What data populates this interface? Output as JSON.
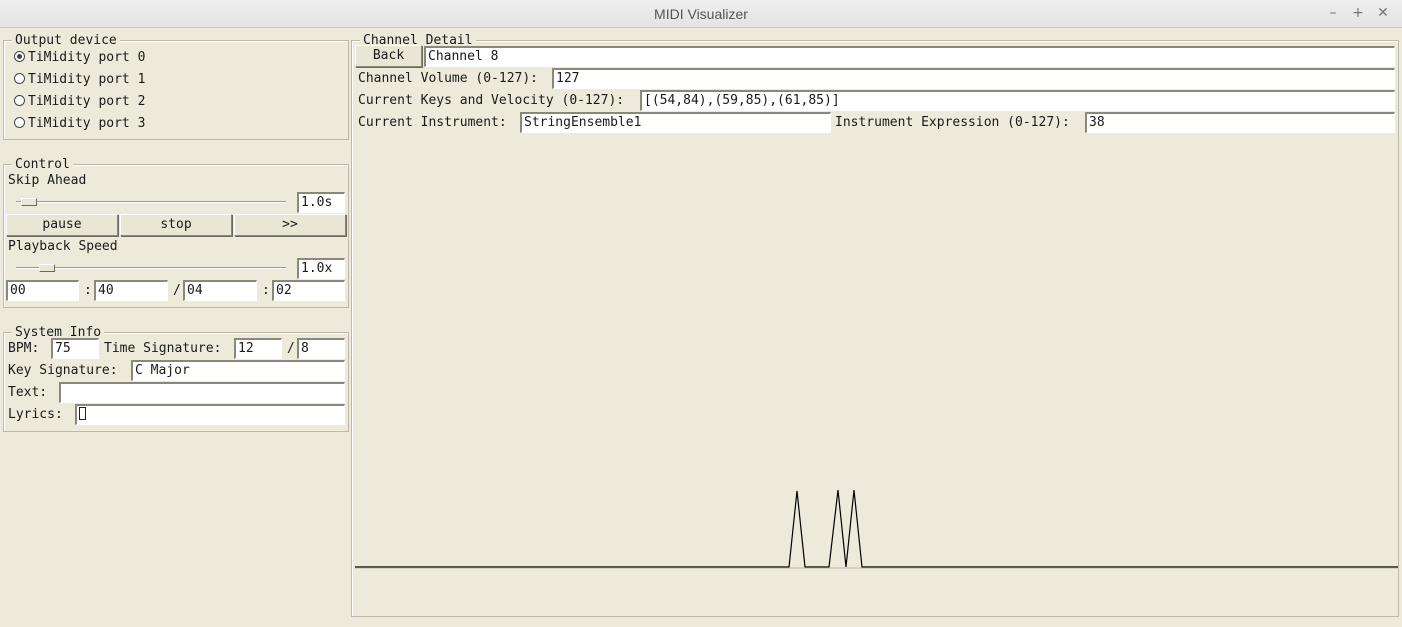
{
  "window": {
    "title": "MIDI Visualizer"
  },
  "output_device": {
    "legend": "Output device",
    "ports": [
      "TiMidity port 0",
      "TiMidity port 1",
      "TiMidity port 2",
      "TiMidity port 3"
    ],
    "selected_index": 0
  },
  "control": {
    "legend": "Control",
    "skip_ahead_label": "Skip Ahead",
    "skip_ahead_value": "1.0s",
    "skip_ahead_slider": 0.02,
    "pause_label": "pause",
    "stop_label": "stop",
    "forward_label": ">>",
    "playback_speed_label": "Playback Speed",
    "playback_speed_value": "1.0x",
    "playback_speed_slider": 0.09,
    "time": {
      "cur_min": "00",
      "cur_sec": "40",
      "total_min": "04",
      "total_sec": "02",
      "sep1": ":",
      "sep2": "/",
      "sep3": ":"
    }
  },
  "system_info": {
    "legend": "System Info",
    "bpm_label": "BPM:",
    "bpm_value": "75",
    "time_sig_label": "Time Signature:",
    "time_sig_num": "12",
    "time_sig_sep": "/",
    "time_sig_den": "8",
    "key_sig_label": "Key Signature:",
    "key_sig_value": "C Major",
    "text_label": "Text:",
    "text_value": "",
    "lyrics_label": "Lyrics:",
    "lyrics_value": ""
  },
  "channel_detail": {
    "legend": "Channel Detail",
    "back_label": "Back",
    "channel_name": "Channel 8",
    "volume_label": "Channel Volume (0-127):",
    "volume_value": "127",
    "keys_label": "Current Keys and Velocity (0-127):",
    "keys_value": "[(54,84),(59,85),(61,85)]",
    "instrument_label": "Current Instrument:",
    "instrument_value": "StringEnsemble1",
    "expression_label": "Instrument Expression (0-127):",
    "expression_value": "38"
  }
}
